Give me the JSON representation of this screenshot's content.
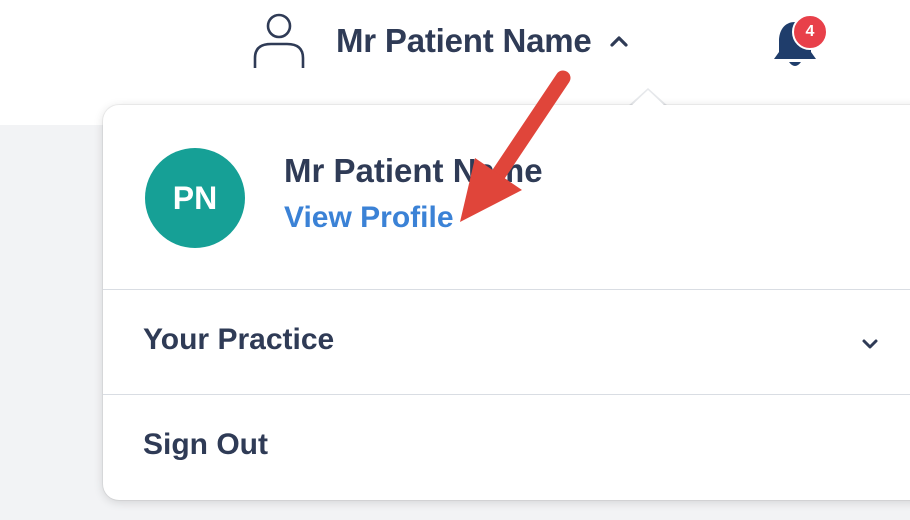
{
  "header": {
    "user_name": "Mr Patient Name",
    "user_icon": "person-outline-icon",
    "expand_icon": "chevron-up-icon",
    "notifications": {
      "icon": "bell-icon",
      "count": "4",
      "badge_color": "#e8404a"
    }
  },
  "dropdown": {
    "avatar_initials": "PN",
    "avatar_color": "#16a096",
    "profile_name": "Mr Patient Name",
    "view_profile_label": "View Profile",
    "items": [
      {
        "label": "Your Practice",
        "icon": "chevron-down-icon"
      },
      {
        "label": "Sign Out"
      }
    ]
  },
  "colors": {
    "text_dark": "#2f3b56",
    "link_blue": "#3b82d6",
    "annotation_arrow": "#e0453a"
  }
}
